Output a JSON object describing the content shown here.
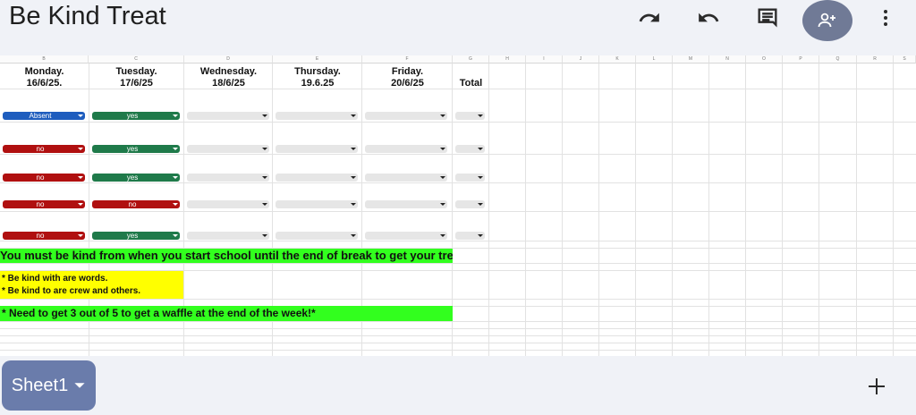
{
  "app": {
    "title": "Be Kind Treat"
  },
  "toolbar": {
    "undo_icon": "undo-icon",
    "redo_icon": "redo-icon",
    "comment_icon": "comment-icon",
    "share_icon": "person-add-icon",
    "more_icon": "more-vert-icon"
  },
  "columns": [
    "B",
    "C",
    "D",
    "E",
    "F",
    "G",
    "H",
    "I",
    "J",
    "K",
    "L",
    "M",
    "N",
    "O",
    "P",
    "Q",
    "R",
    "S"
  ],
  "day_headers": [
    {
      "line1": "Monday.",
      "line2": "16/6/25."
    },
    {
      "line1": "Tuesday.",
      "line2": "17/6/25"
    },
    {
      "line1": "Wednesday.",
      "line2": "18/6/25"
    },
    {
      "line1": "Thursday.",
      "line2": "19.6.25"
    },
    {
      "line1": "Friday.",
      "line2": "20/6/25"
    },
    {
      "line1": "",
      "line2": "Total"
    }
  ],
  "rows": [
    [
      "Absent",
      "yes",
      "",
      "",
      "",
      ""
    ],
    [
      "no",
      "yes",
      "",
      "",
      "",
      ""
    ],
    [
      "no",
      "yes",
      "",
      "",
      "",
      ""
    ],
    [
      "no",
      "no",
      "",
      "",
      "",
      ""
    ],
    [
      "no",
      "yes",
      "",
      "",
      "",
      ""
    ]
  ],
  "banner_rule": "You must be kind from when you start school until the end of break to get your treat",
  "rules": [
    "* Be kind with are words.",
    "* Be kind to are crew and others."
  ],
  "banner_goal": "* Need to get 3 out of 5 to get a waffle at the end of the week!*",
  "colors": {
    "green": "#32ff1e",
    "yellow": "#ffff00",
    "absent": "#1e5dbe",
    "yes": "#1f7a4a",
    "no": "#b01010"
  },
  "bottom": {
    "sheet_tab": "Sheet1",
    "add_icon": "plus-icon"
  }
}
